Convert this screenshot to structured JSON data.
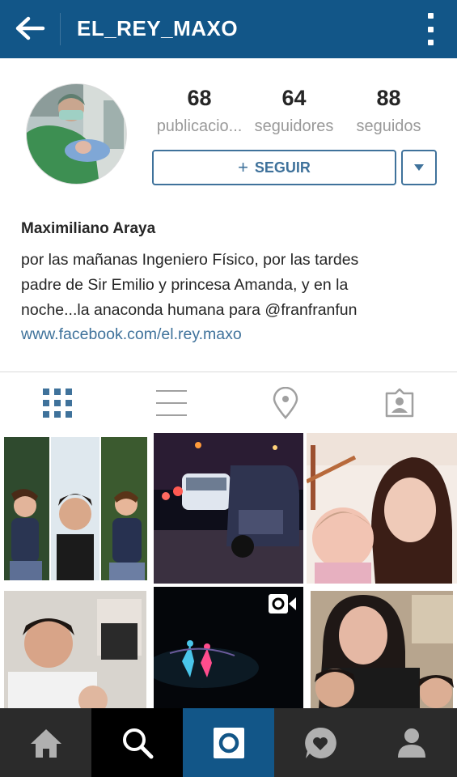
{
  "header": {
    "username": "EL_REY_MAXO",
    "back_icon": "arrow-left-icon",
    "more_icon": "more-vertical-icon"
  },
  "profile": {
    "stats": [
      {
        "value": "68",
        "label": "publicacio..."
      },
      {
        "value": "64",
        "label": "seguidores"
      },
      {
        "value": "88",
        "label": "seguidos"
      }
    ],
    "follow_label": "SEGUIR",
    "follow_prefix": "+",
    "full_name": "Maximiliano Araya",
    "bio_lines": [
      "por las mañanas Ingeniero Físico, por las tardes",
      "padre de Sir Emilio y princesa Amanda, y en la",
      "noche...la anaconda humana para @franfranfun"
    ],
    "website": "www.facebook.com/el.rey.maxo"
  },
  "tabs": {
    "active": "grid",
    "items": [
      "grid-icon",
      "list-icon",
      "location-pin-icon",
      "tagged-photos-icon"
    ]
  },
  "photos": {
    "count_visible": 6,
    "video_badge_icon": "video-camera-icon"
  },
  "bottom_nav": {
    "items": [
      "home-icon",
      "search-icon",
      "camera-icon",
      "activity-heart-icon",
      "profile-icon"
    ],
    "active": "search"
  },
  "colors": {
    "brand_bar": "#125688",
    "accent": "#3f729b",
    "nav_bg": "#2b2b2b"
  }
}
